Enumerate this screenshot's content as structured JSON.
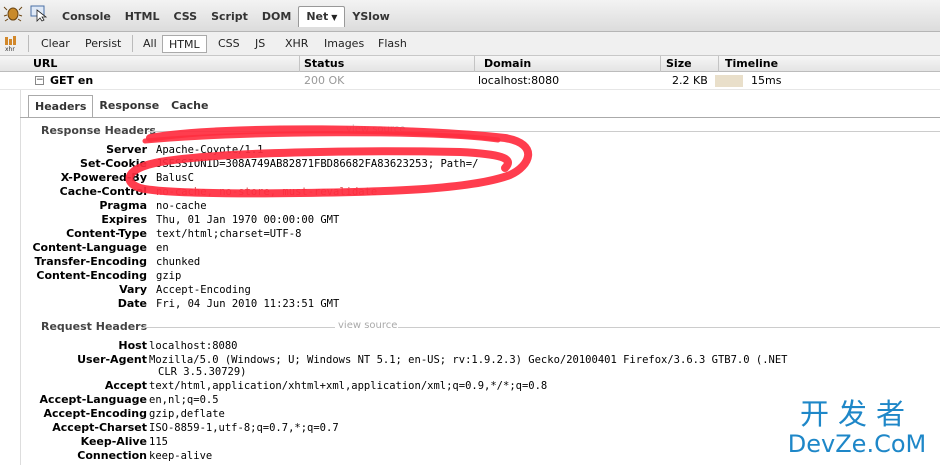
{
  "topbar": {
    "tabs": [
      "Console",
      "HTML",
      "CSS",
      "Script",
      "DOM",
      "Net",
      "YSlow"
    ],
    "active_tab": "Net"
  },
  "toolbar2": {
    "buttons": [
      "Clear",
      "Persist",
      "All",
      "HTML",
      "CSS",
      "JS",
      "XHR",
      "Images",
      "Flash"
    ],
    "active_filter": "HTML",
    "xhr_label": "xhr"
  },
  "columns": {
    "url": "URL",
    "status": "Status",
    "domain": "Domain",
    "size": "Size",
    "timeline": "Timeline"
  },
  "request": {
    "method_url": "GET en",
    "status": "200 OK",
    "domain": "localhost:8080",
    "size": "2.2 KB",
    "time": "15ms",
    "toggle": "−"
  },
  "detail_tabs": [
    "Headers",
    "Response",
    "Cache"
  ],
  "response_headers": {
    "title": "Response Headers",
    "view_source": "view source",
    "rows": [
      {
        "name": "Server",
        "value": "Apache-Coyote/1.1"
      },
      {
        "name": "Set-Cookie",
        "value": "JSESSIONID=308A749AB82871FBD86682FA83623253; Path=/"
      },
      {
        "name": "X-Powered-By",
        "value": "BalusC"
      },
      {
        "name": "Cache-Control",
        "value": "no-cache, no-store, must-revalidate"
      },
      {
        "name": "Pragma",
        "value": "no-cache"
      },
      {
        "name": "Expires",
        "value": "Thu, 01 Jan 1970 00:00:00 GMT"
      },
      {
        "name": "Content-Type",
        "value": "text/html;charset=UTF-8"
      },
      {
        "name": "Content-Language",
        "value": "en"
      },
      {
        "name": "Transfer-Encoding",
        "value": "chunked"
      },
      {
        "name": "Content-Encoding",
        "value": "gzip"
      },
      {
        "name": "Vary",
        "value": "Accept-Encoding"
      },
      {
        "name": "Date",
        "value": "Fri, 04 Jun 2010 11:23:51 GMT"
      }
    ]
  },
  "request_headers": {
    "title": "Request Headers",
    "view_source": "view source",
    "rows": [
      {
        "name": "Host",
        "value": "localhost:8080"
      },
      {
        "name": "User-Agent",
        "value": "Mozilla/5.0 (Windows; U; Windows NT 5.1; en-US; rv:1.9.2.3) Gecko/20100401 Firefox/3.6.3 GTB7.0 (.NET",
        "value2": "CLR 3.5.30729)"
      },
      {
        "name": "Accept",
        "value": "text/html,application/xhtml+xml,application/xml;q=0.9,*/*;q=0.8"
      },
      {
        "name": "Accept-Language",
        "value": "en,nl;q=0.5"
      },
      {
        "name": "Accept-Encoding",
        "value": "gzip,deflate"
      },
      {
        "name": "Accept-Charset",
        "value": "ISO-8859-1,utf-8;q=0.7,*;q=0.7"
      },
      {
        "name": "Keep-Alive",
        "value": "115"
      },
      {
        "name": "Connection",
        "value": "keep-alive"
      }
    ]
  },
  "watermark": {
    "cn": "开发者",
    "en": "DevZe.CoM"
  },
  "colors": {
    "scribble": "#ff2d3f",
    "watermark": "#1e87c8",
    "red_value": "#d64d4d"
  }
}
